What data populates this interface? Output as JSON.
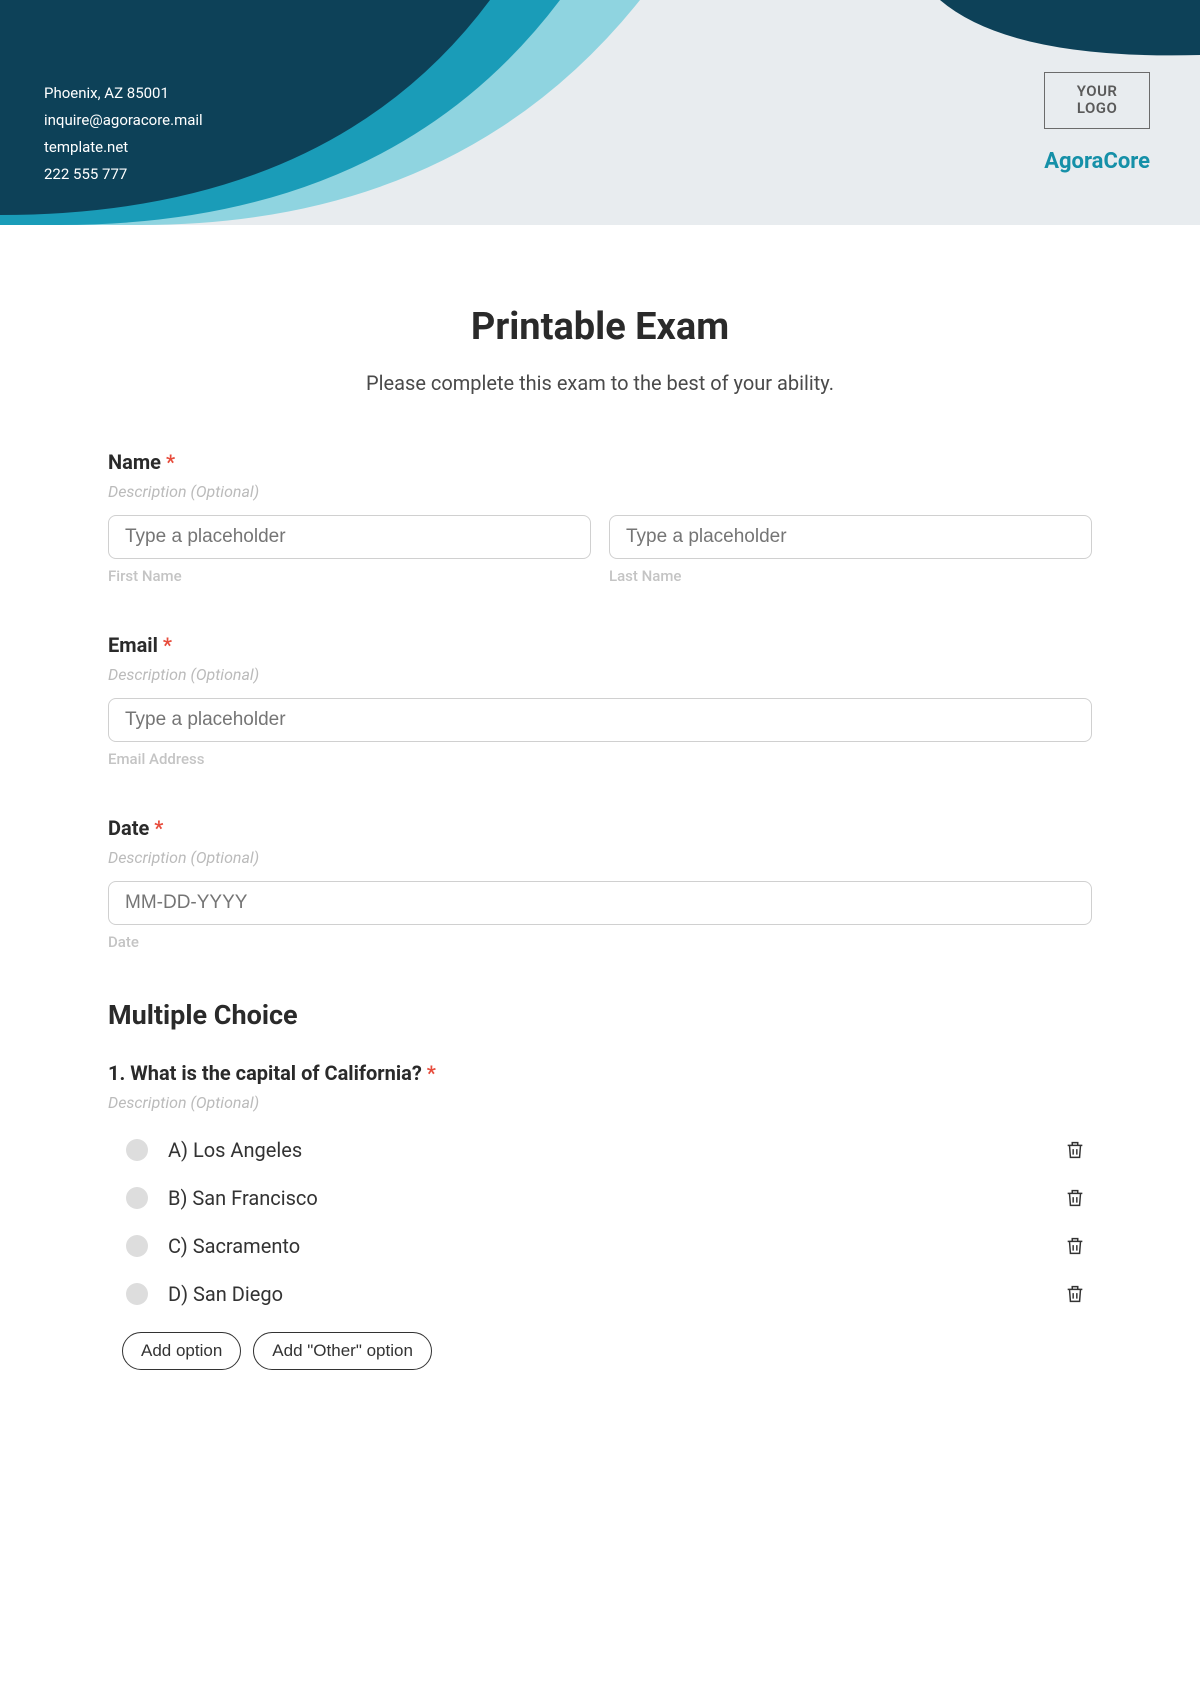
{
  "header": {
    "address": "Phoenix, AZ 85001",
    "email": "inquire@agoracore.mail",
    "website": "template.net",
    "phone": "222 555 777",
    "logo_line1": "YOUR",
    "logo_line2": "LOGO",
    "brand": "AgoraCore"
  },
  "form": {
    "title": "Printable Exam",
    "subtitle": "Please complete this exam to the best of your ability.",
    "desc_placeholder": "Description (Optional)"
  },
  "fields": {
    "name": {
      "label": "Name",
      "first_placeholder": "Type a placeholder",
      "first_sub": "First Name",
      "last_placeholder": "Type a placeholder",
      "last_sub": "Last Name"
    },
    "email": {
      "label": "Email",
      "placeholder": "Type a placeholder",
      "sub": "Email Address"
    },
    "date": {
      "label": "Date",
      "placeholder": "MM-DD-YYYY",
      "sub": "Date"
    }
  },
  "mc": {
    "heading": "Multiple Choice",
    "q1": {
      "text": "1. What is the capital of California?",
      "options": [
        "A) Los Angeles",
        "B) San Francisco",
        "C) Sacramento",
        "D) San Diego"
      ]
    },
    "add_option": "Add option",
    "add_other": "Add \"Other\" option"
  }
}
